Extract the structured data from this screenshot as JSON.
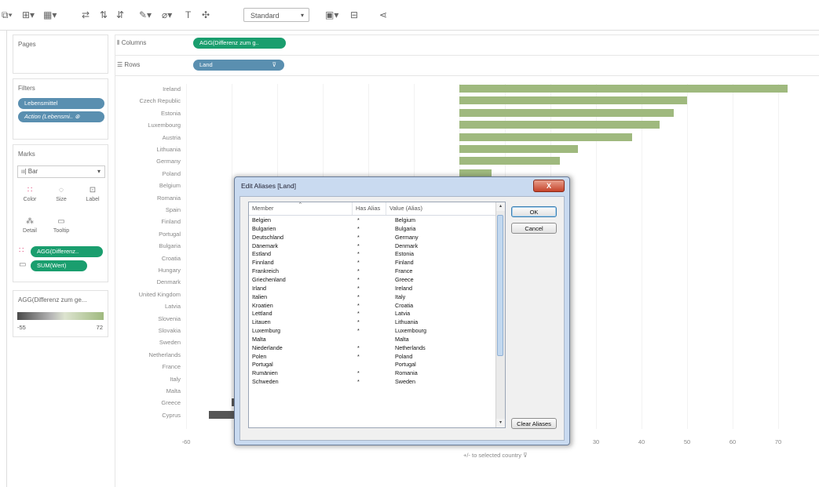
{
  "toolbar": {
    "standard_label": "Standard",
    "icons": [
      "data-source-icon",
      "new-sheet-icon",
      "duplicate-icon",
      "swap-icon",
      "sort-asc-icon",
      "sort-desc-icon",
      "highlight-icon",
      "group-icon",
      "label-icon",
      "pin-icon",
      "fit-icon",
      "show-cards-icon",
      "presentation-icon",
      "share-icon"
    ]
  },
  "pages": {
    "title": "Pages"
  },
  "filters": {
    "title": "Filters",
    "items": [
      "Lebensmittel",
      "Action (Lebensmi.. ⊛"
    ]
  },
  "marks": {
    "title": "Marks",
    "type_label": "Bar",
    "buttons": [
      "Color",
      "Size",
      "Label",
      "Detail",
      "Tooltip"
    ],
    "fields": [
      "AGG(Differenz..",
      "SUM(Wert)"
    ]
  },
  "legend": {
    "title": "AGG(Differenz zum ge...",
    "min": "-55",
    "max": "72"
  },
  "shelves": {
    "columns_label": "Columns",
    "columns_pill": "AGG(Differenz zum g..",
    "rows_label": "Rows",
    "rows_pill": "Land"
  },
  "chart_data": {
    "type": "bar",
    "categories": [
      "Ireland",
      "Czech Republic",
      "Estonia",
      "Luxembourg",
      "Austria",
      "Lithuania",
      "Germany",
      "Poland",
      "Belgium",
      "Romania",
      "Spain",
      "Finland",
      "Portugal",
      "Bulgaria",
      "Croatia",
      "Hungary",
      "Denmark",
      "United Kingdom",
      "Latvia",
      "Slovenia",
      "Slovakia",
      "Sweden",
      "Netherlands",
      "France",
      "Italy",
      "Malta",
      "Greece",
      "Cyprus"
    ],
    "values": [
      72,
      50,
      47,
      44,
      38,
      26,
      22,
      7,
      null,
      null,
      null,
      null,
      null,
      null,
      null,
      null,
      null,
      null,
      null,
      null,
      null,
      null,
      null,
      null,
      null,
      null,
      -50,
      -55
    ],
    "xlabel": "+/- to selected country",
    "x_ticks": [
      "-60",
      "30",
      "40",
      "50",
      "60",
      "70"
    ],
    "color": "#9fb97e"
  },
  "dialog": {
    "title": "Edit Aliases [Land]",
    "close_label": "X",
    "headers": [
      "Member",
      "Has Alias",
      "Value (Alias)"
    ],
    "rows": [
      [
        "Belgien",
        "*",
        "Belgium"
      ],
      [
        "Bulgarien",
        "*",
        "Bulgaria"
      ],
      [
        "Deutschland",
        "*",
        "Germany"
      ],
      [
        "Dänemark",
        "*",
        "Denmark"
      ],
      [
        "Estland",
        "*",
        "Estonia"
      ],
      [
        "Finnland",
        "*",
        "Finland"
      ],
      [
        "Frankreich",
        "*",
        "France"
      ],
      [
        "Griechenland",
        "*",
        "Greece"
      ],
      [
        "Irland",
        "*",
        "Ireland"
      ],
      [
        "Italien",
        "*",
        "Italy"
      ],
      [
        "Kroatien",
        "*",
        "Croatia"
      ],
      [
        "Lettland",
        "*",
        "Latvia"
      ],
      [
        "Litauen",
        "*",
        "Lithuania"
      ],
      [
        "Luxemburg",
        "*",
        "Luxembourg"
      ],
      [
        "Malta",
        "",
        "Malta"
      ],
      [
        "Niederlande",
        "*",
        "Netherlands"
      ],
      [
        "Polen",
        "*",
        "Poland"
      ],
      [
        "Portugal",
        "",
        "Portugal"
      ],
      [
        "Rumänien",
        "*",
        "Romania"
      ],
      [
        "Schweden",
        "*",
        "Sweden"
      ]
    ],
    "ok_label": "OK",
    "cancel_label": "Cancel",
    "clear_label": "Clear Aliases"
  }
}
